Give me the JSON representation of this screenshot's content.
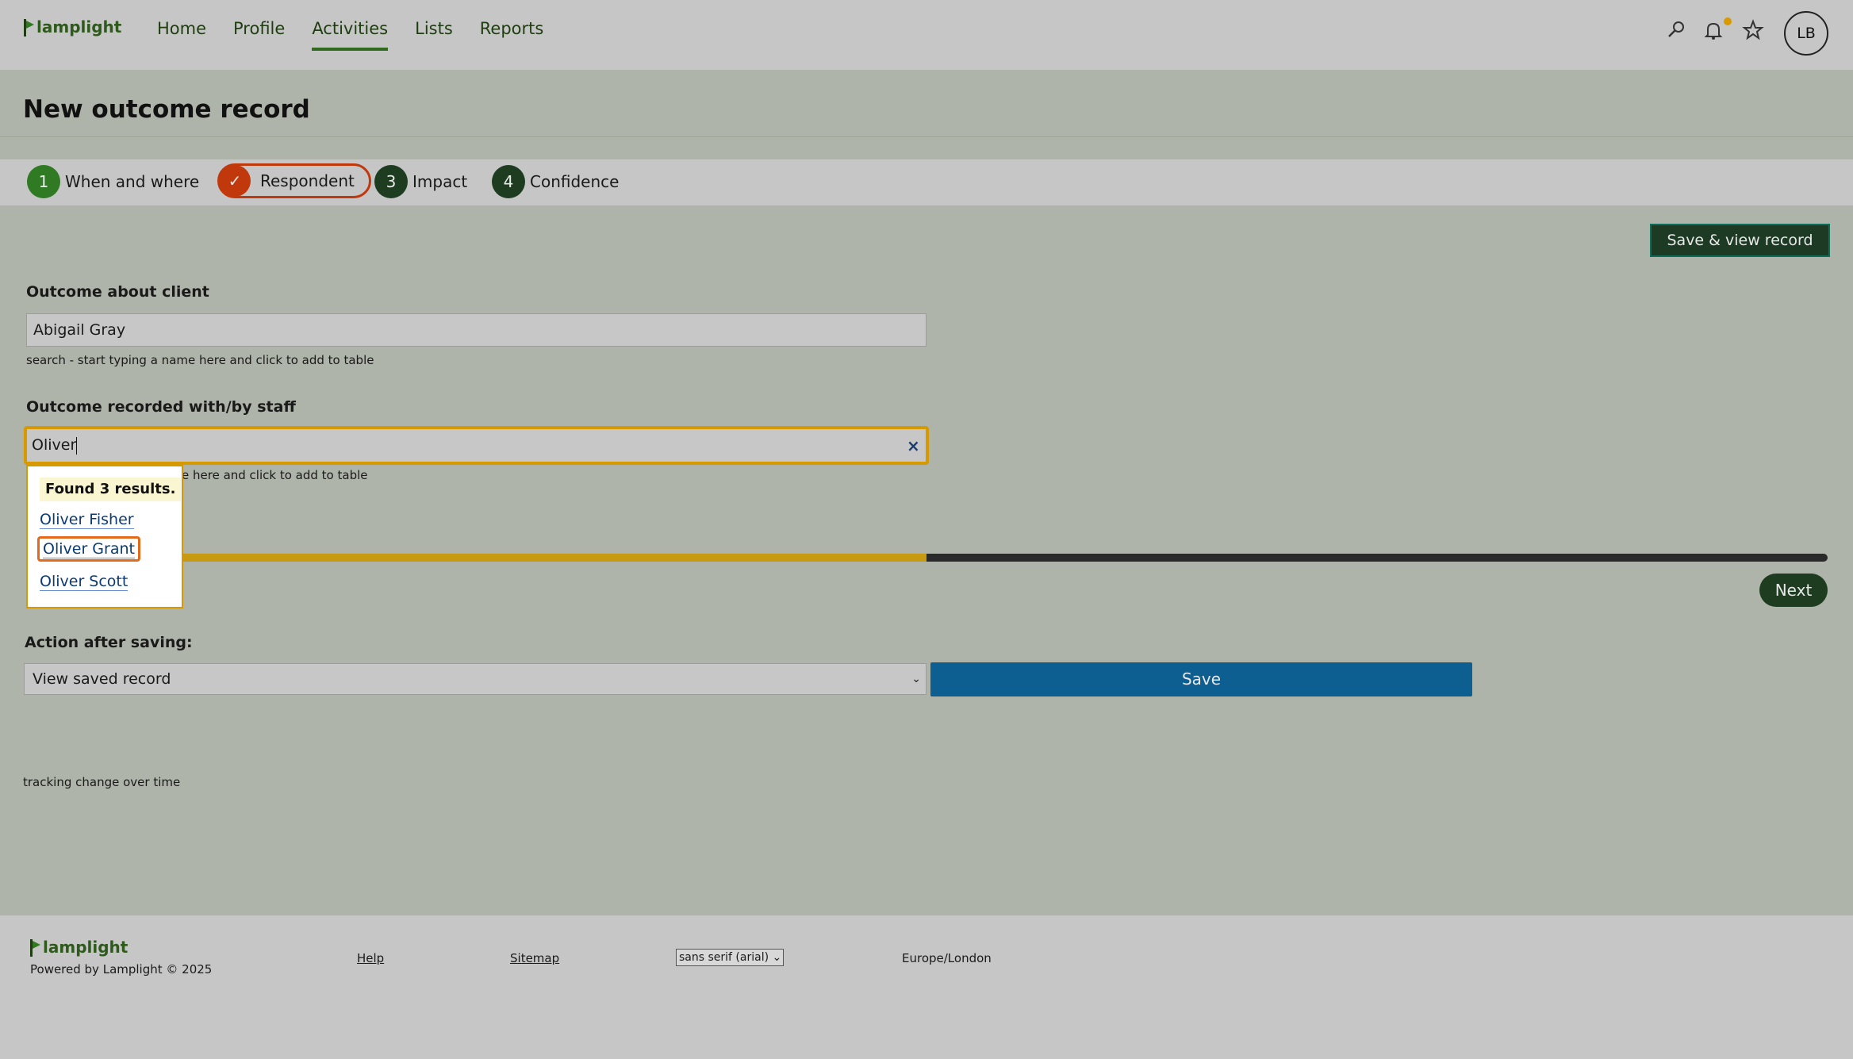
{
  "app": {
    "logo_text": "lamplight"
  },
  "nav": {
    "links": [
      "Home",
      "Profile",
      "Activities",
      "Lists",
      "Reports"
    ],
    "active": "Activities",
    "avatar_initials": "LB"
  },
  "page": {
    "title": "New outcome record"
  },
  "steps": [
    {
      "num": "1",
      "label": "When and where"
    },
    {
      "num": "✓",
      "label": "Respondent"
    },
    {
      "num": "3",
      "label": "Impact"
    },
    {
      "num": "4",
      "label": "Confidence"
    }
  ],
  "actions": {
    "save_view_label": "Save & view record",
    "next_label": "Next",
    "save_label": "Save"
  },
  "client_field": {
    "label": "Outcome about client",
    "value": "Abigail Gray",
    "help": "search - start typing a name here and click to add to table"
  },
  "staff_field": {
    "label": "Outcome recorded with/by staff",
    "value": "Oliver",
    "help": "search - start typing a name here and click to add to table",
    "help_visible": "e here and click to add to table",
    "clear_icon": "×"
  },
  "dropdown": {
    "found_text": "Found 3 results.",
    "results": [
      "Oliver Fisher",
      "Oliver Grant",
      "Oliver Scott"
    ],
    "highlighted": "Oliver Grant"
  },
  "progress": {
    "fraction": 0.42
  },
  "after_save": {
    "label": "Action after saving:",
    "selected": "View saved record"
  },
  "note": "tracking change over time",
  "footer": {
    "logo_text": "lamplight",
    "powered": "Powered by Lamplight © 2025",
    "help_link": "Help",
    "sitemap_link": "Sitemap",
    "font_select": "sans serif (arial)",
    "timezone": "Europe/London"
  },
  "colors": {
    "accent_green": "#1e3d20",
    "focus_amber": "#d69a00",
    "current_step": "#c0380c",
    "save_blue": "#0d5e91"
  }
}
